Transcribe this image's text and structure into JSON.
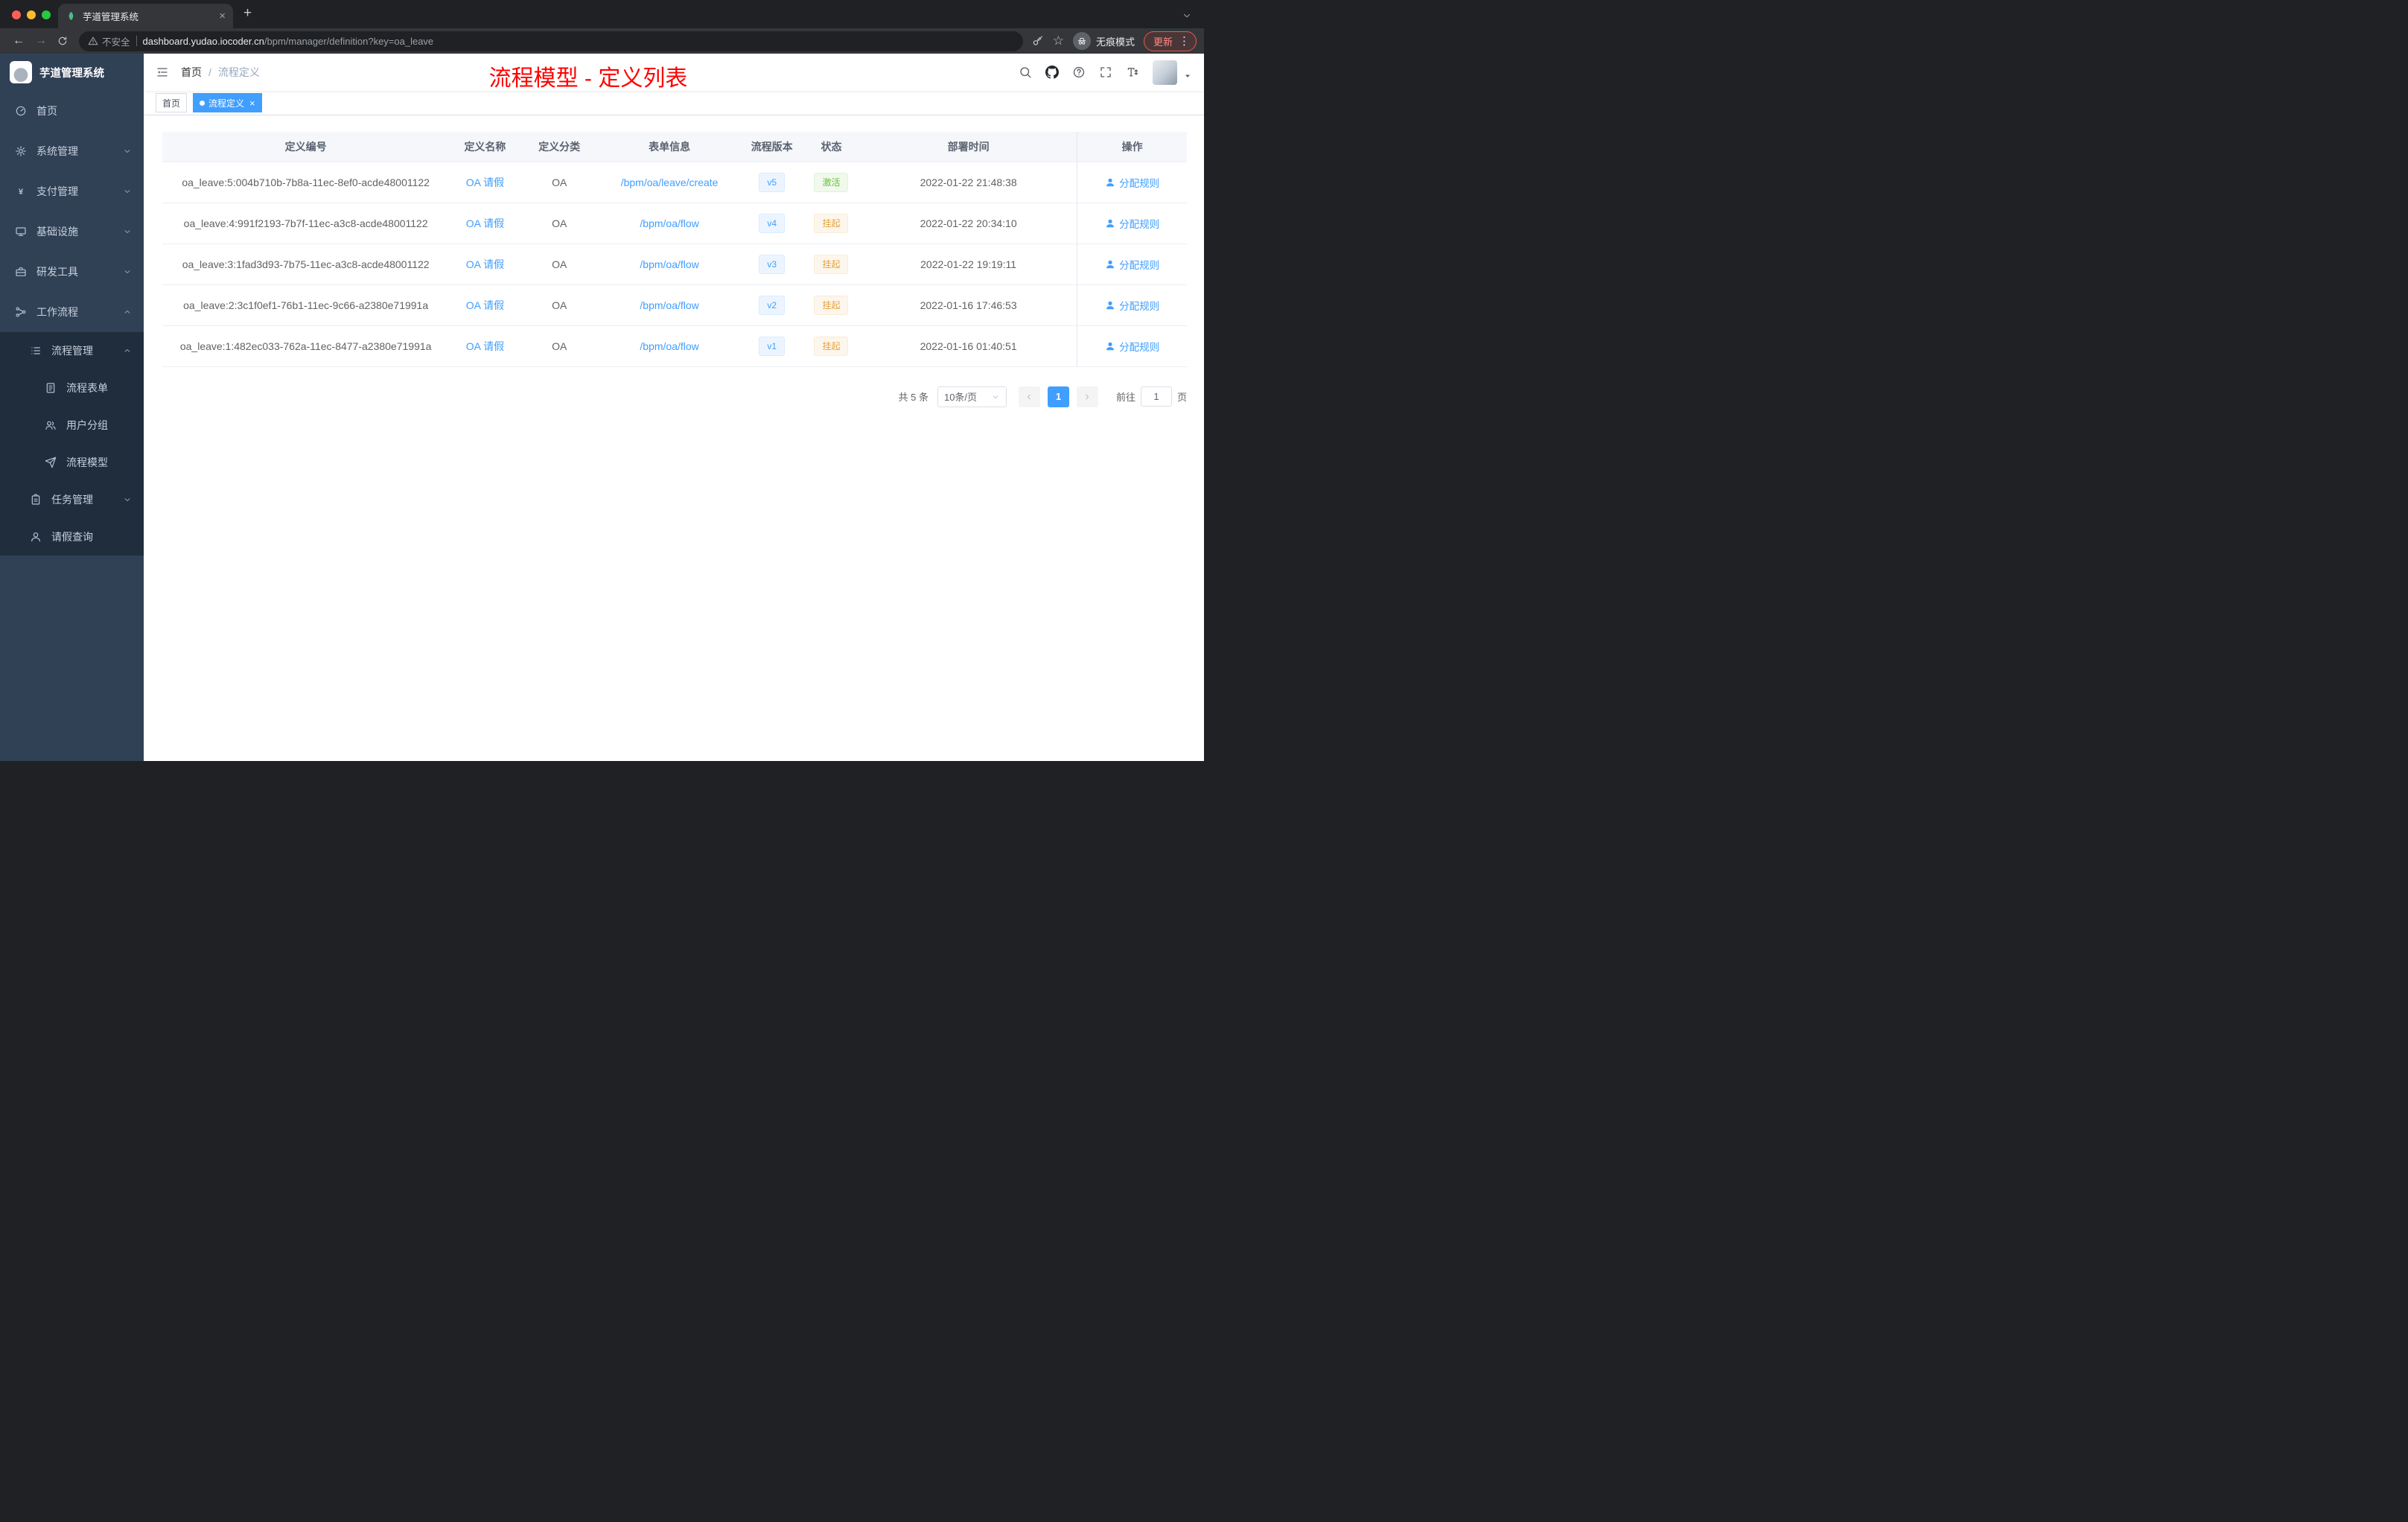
{
  "colors": {
    "accent": "#409eff",
    "success": "#67c23a",
    "warning": "#e6a23c",
    "annotation_red": "#fe0000",
    "sidebar_bg": "#304156",
    "submenu_bg": "#1f2d3d"
  },
  "browser": {
    "tab_title": "芋道管理系统",
    "close_glyph": "×",
    "new_tab_glyph": "+",
    "back_glyph": "←",
    "forward_glyph": "→",
    "security_label": "不安全",
    "url_domain": "dashboard.yudao.iocoder.cn",
    "url_path": "/bpm/manager/definition?key=oa_leave",
    "star_glyph": "☆",
    "incognito_label": "无痕模式",
    "update_label": "更新",
    "menu_glyph": "⋮"
  },
  "sidebar": {
    "logo_title": "芋道管理系统",
    "menu": [
      {
        "label": "首页",
        "icon": "dashboard-icon"
      },
      {
        "label": "系统管理",
        "icon": "gear-icon"
      },
      {
        "label": "支付管理",
        "icon": "yen-icon"
      },
      {
        "label": "基础设施",
        "icon": "monitor-icon"
      },
      {
        "label": "研发工具",
        "icon": "toolbox-icon"
      },
      {
        "label": "工作流程",
        "icon": "workflow-icon"
      }
    ],
    "process_mgmt": {
      "label": "流程管理",
      "icon": "list-icon"
    },
    "process_children": [
      {
        "label": "流程表单",
        "icon": "form-icon"
      },
      {
        "label": "用户分组",
        "icon": "users-icon"
      },
      {
        "label": "流程模型",
        "icon": "send-icon"
      }
    ],
    "task_mgmt": {
      "label": "任务管理",
      "icon": "task-icon"
    },
    "leave_query": {
      "label": "请假查询",
      "icon": "user-icon"
    }
  },
  "header": {
    "breadcrumb_home": "首页",
    "breadcrumb_separator": "/",
    "breadcrumb_current": "流程定义"
  },
  "annotation": {
    "text": "流程模型 - 定义列表"
  },
  "tags": [
    {
      "label": "首页",
      "active": false
    },
    {
      "label": "流程定义",
      "active": true,
      "close_glyph": "×"
    }
  ],
  "table": {
    "columns": [
      "定义编号",
      "定义名称",
      "定义分类",
      "表单信息",
      "流程版本",
      "状态",
      "部署时间",
      "操作"
    ],
    "rows": [
      {
        "id": "oa_leave:5:004b710b-7b8a-11ec-8ef0-acde48001122",
        "name": "OA 请假",
        "category": "OA",
        "form": "/bpm/oa/leave/create",
        "version": "v5",
        "status": "激活",
        "time": "2022-01-22 21:48:38",
        "action": "分配规则"
      },
      {
        "id": "oa_leave:4:991f2193-7b7f-11ec-a3c8-acde48001122",
        "name": "OA 请假",
        "category": "OA",
        "form": "/bpm/oa/flow",
        "version": "v4",
        "status": "挂起",
        "time": "2022-01-22 20:34:10",
        "action": "分配规则"
      },
      {
        "id": "oa_leave:3:1fad3d93-7b75-11ec-a3c8-acde48001122",
        "name": "OA 请假",
        "category": "OA",
        "form": "/bpm/oa/flow",
        "version": "v3",
        "status": "挂起",
        "time": "2022-01-22 19:19:11",
        "action": "分配规则"
      },
      {
        "id": "oa_leave:2:3c1f0ef1-76b1-11ec-9c66-a2380e71991a",
        "name": "OA 请假",
        "category": "OA",
        "form": "/bpm/oa/flow",
        "version": "v2",
        "status": "挂起",
        "time": "2022-01-16 17:46:53",
        "action": "分配规则"
      },
      {
        "id": "oa_leave:1:482ec033-762a-11ec-8477-a2380e71991a",
        "name": "OA 请假",
        "category": "OA",
        "form": "/bpm/oa/flow",
        "version": "v1",
        "status": "挂起",
        "time": "2022-01-16 01:40:51",
        "action": "分配规则"
      }
    ]
  },
  "pagination": {
    "total": "共 5 条",
    "page_size": "10条/页",
    "current_page": "1",
    "goto_label": "前往",
    "goto_value": "1",
    "page_unit": "页"
  }
}
